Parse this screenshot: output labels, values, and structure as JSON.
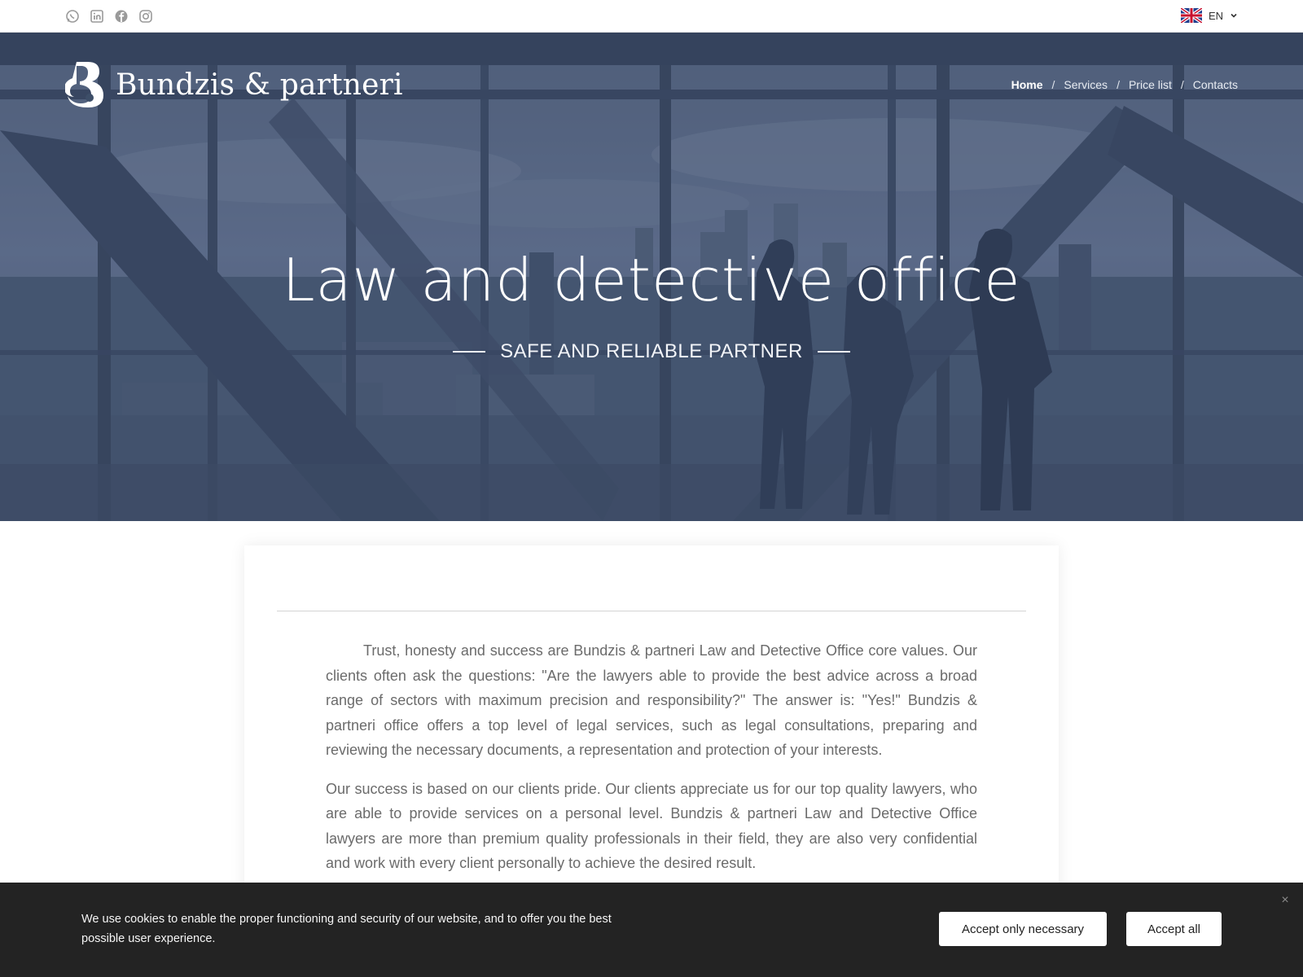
{
  "topbar": {
    "social_icons": [
      "whatsapp-icon",
      "linkedin-icon",
      "facebook-icon",
      "instagram-icon"
    ],
    "language": {
      "code": "EN",
      "flag": "uk-flag-icon"
    }
  },
  "brand": {
    "name": "Bundzis & partneri",
    "logo_letter": "B"
  },
  "nav": {
    "items": [
      {
        "label": "Home",
        "active": true
      },
      {
        "label": "Services",
        "active": false
      },
      {
        "label": "Price list",
        "active": false
      },
      {
        "label": "Contacts",
        "active": false
      }
    ],
    "separator": "/"
  },
  "hero": {
    "title": "Law and detective office",
    "subtitle": "SAFE AND RELIABLE PARTNER",
    "overlay_color": "#3d4e68"
  },
  "content": {
    "paragraphs": [
      "Trust, honesty and success are Bundzis & partneri Law and Detective Office core values. Our clients often ask the questions: \"Are the lawyers able to provide the best advice across a broad range of sectors with maximum precision and responsibility?\" The answer is: \"Yes!\" Bundzis & partneri office offers a top level of legal services, such as legal consultations, preparing and reviewing the necessary documents, a representation and protection of your interests.",
      "Our success is based on our clients pride. Our clients appreciate us for our top quality lawyers, who are able to provide services on a personal level. Bundzis & partneri Law and Detective Office lawyers are more than premium quality professionals in their field, they are also very confidential and work with every client personally to achieve the desired result."
    ]
  },
  "cookie": {
    "text": "We use cookies to enable the proper functioning and security of our website, and to offer you the best possible user experience.",
    "accept_necessary": "Accept only necessary",
    "accept_all": "Accept all",
    "close": "×",
    "background": "#232323"
  }
}
